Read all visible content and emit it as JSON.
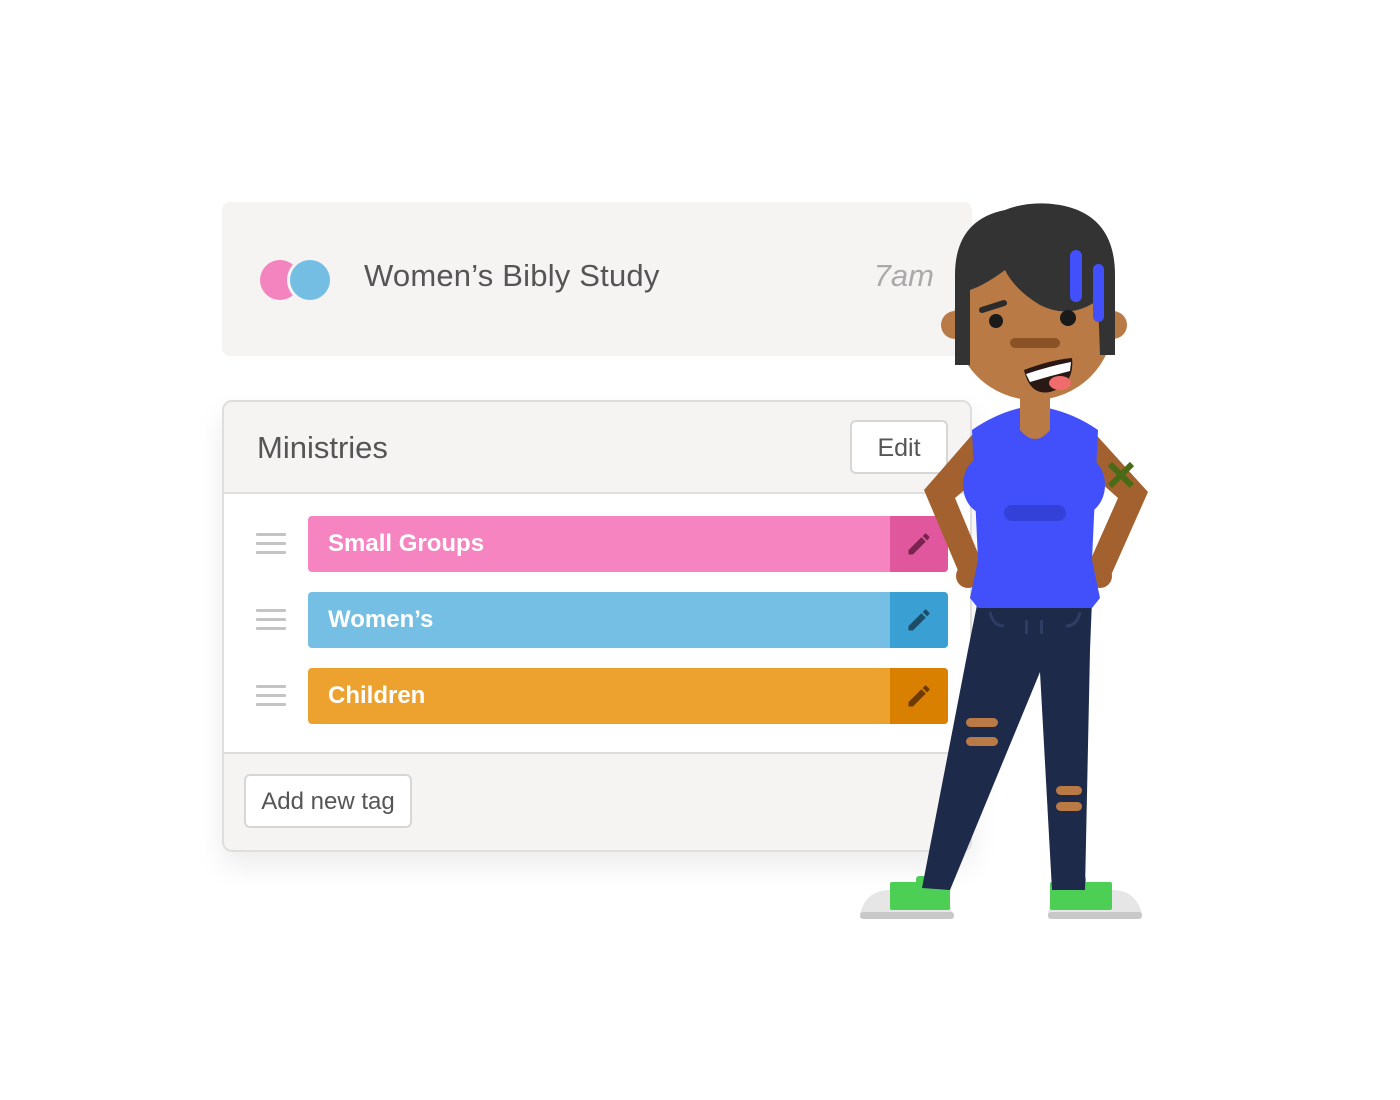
{
  "event": {
    "title": "Women’s Bibly Study",
    "time": "7am",
    "dot_colors": [
      "#f384bf",
      "#74bde3"
    ]
  },
  "ministries": {
    "title": "Ministries",
    "edit_label": "Edit",
    "add_tag_label": "Add new tag",
    "tags": [
      {
        "label": "Small Groups",
        "color": "#f584c0",
        "edit_color": "#e0579e",
        "icon_color": "#7a2250"
      },
      {
        "label": "Women’s",
        "color": "#76bfe4",
        "edit_color": "#3aa0d3",
        "icon_color": "#1d4c66"
      },
      {
        "label": "Children",
        "color": "#eda22f",
        "edit_color": "#d98000",
        "icon_color": "#6e3a00"
      }
    ]
  }
}
